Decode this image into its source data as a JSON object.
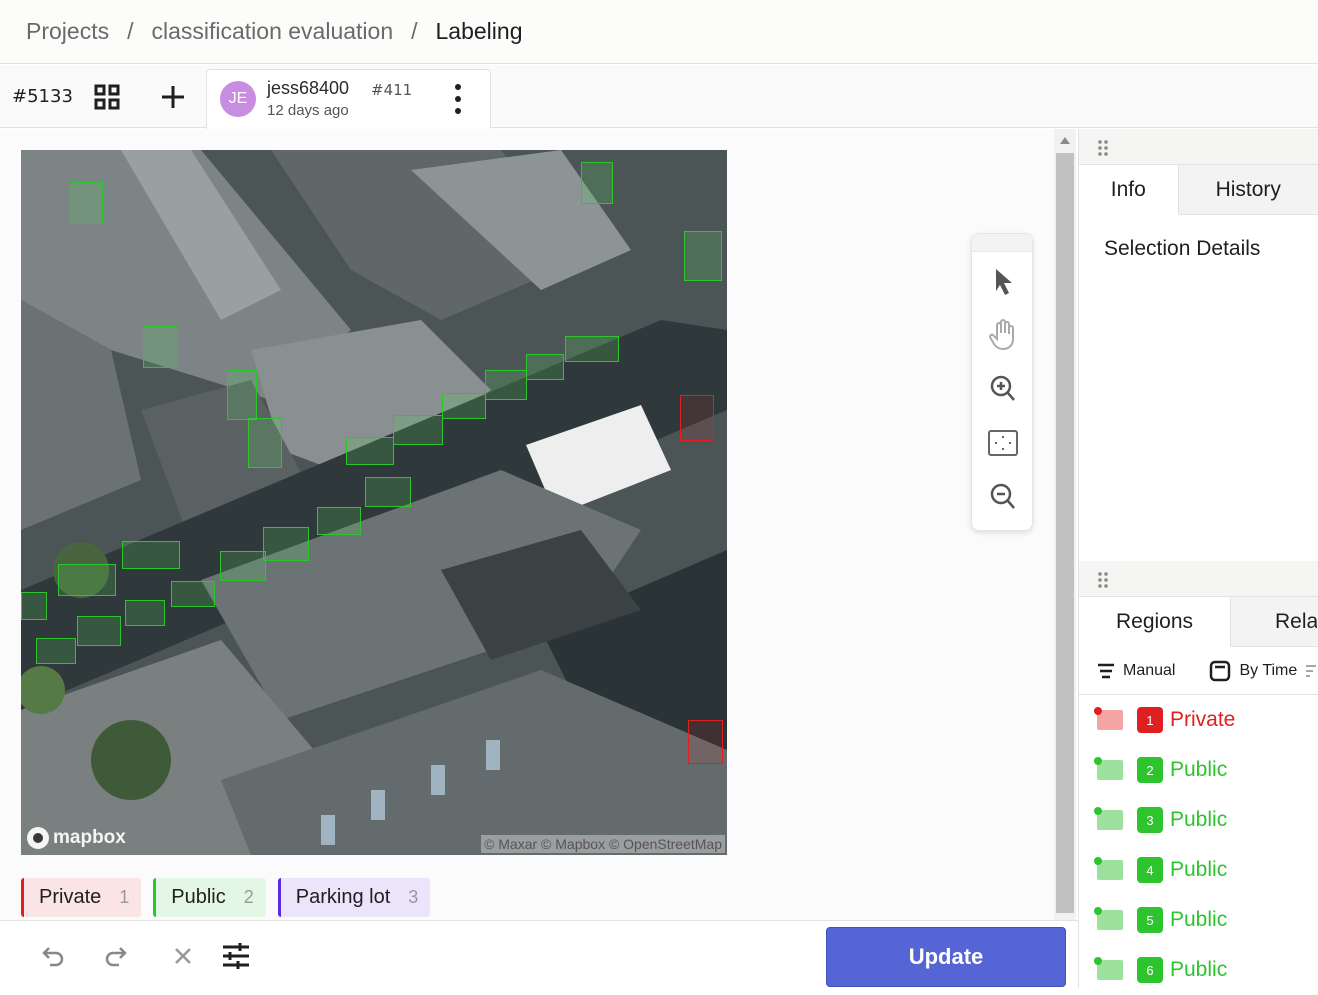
{
  "breadcrumb": {
    "items": [
      "Projects",
      "classification evaluation",
      "Labeling"
    ],
    "separator": "/"
  },
  "task": {
    "id": "#5133",
    "annotation": {
      "avatar_initials": "JE",
      "user": "jess68400",
      "annotation_id": "#411",
      "time": "12 days ago"
    }
  },
  "canvas": {
    "mapbox_logo": "mapbox",
    "attribution": "© Maxar © Mapbox © OpenStreetMap",
    "tools": [
      "select-pointer-icon",
      "pan-hand-icon",
      "zoom-in-icon",
      "fit-to-screen-icon",
      "zoom-out-icon"
    ]
  },
  "labels": [
    {
      "name": "Private",
      "hotkey": "1",
      "color": "#e02020"
    },
    {
      "name": "Public",
      "hotkey": "2",
      "color": "#2ec42e"
    },
    {
      "name": "Parking lot",
      "hotkey": "3",
      "color": "#5b2be0"
    }
  ],
  "bottom_bar": {
    "icons": [
      "undo-icon",
      "redo-icon",
      "clear-icon",
      "settings-sliders-icon"
    ],
    "update_label": "Update"
  },
  "side_panel": {
    "top_tabs": [
      "Info",
      "History"
    ],
    "selection_title": "Selection Details",
    "bottom_tabs": [
      "Regions",
      "Relations"
    ],
    "sort": {
      "manual": "Manual",
      "by_time": "By Time"
    },
    "regions": [
      {
        "num": "1",
        "label": "Private",
        "color": "#e02020"
      },
      {
        "num": "2",
        "label": "Public",
        "color": "#2ec42e"
      },
      {
        "num": "3",
        "label": "Public",
        "color": "#2ec42e"
      },
      {
        "num": "4",
        "label": "Public",
        "color": "#2ec42e"
      },
      {
        "num": "5",
        "label": "Public",
        "color": "#2ec42e"
      },
      {
        "num": "6",
        "label": "Public",
        "color": "#2ec42e"
      }
    ]
  }
}
